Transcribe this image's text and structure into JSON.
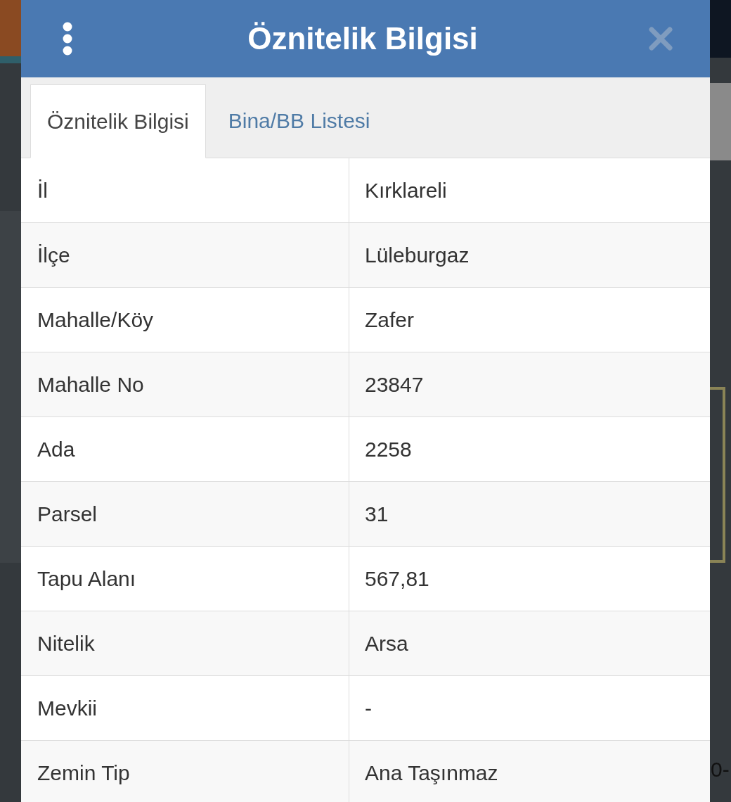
{
  "window": {
    "title": "Öznitelik Bilgisi"
  },
  "tabs": [
    {
      "label": "Öznitelik Bilgisi",
      "selected": true
    },
    {
      "label": "Bina/BB Listesi",
      "selected": false
    }
  ],
  "table": {
    "rows": [
      {
        "label": "İl",
        "value": "Kırklareli"
      },
      {
        "label": "İlçe",
        "value": "Lüleburgaz"
      },
      {
        "label": "Mahalle/Köy",
        "value": "Zafer"
      },
      {
        "label": "Mahalle No",
        "value": "23847"
      },
      {
        "label": "Ada",
        "value": "2258"
      },
      {
        "label": "Parsel",
        "value": "31"
      },
      {
        "label": "Tapu Alanı",
        "value": "567,81"
      },
      {
        "label": "Nitelik",
        "value": "Arsa"
      },
      {
        "label": "Mevkii",
        "value": "-"
      },
      {
        "label": "Zemin Tip",
        "value": "Ana Taşınmaz"
      }
    ]
  },
  "map_label": "0-"
}
